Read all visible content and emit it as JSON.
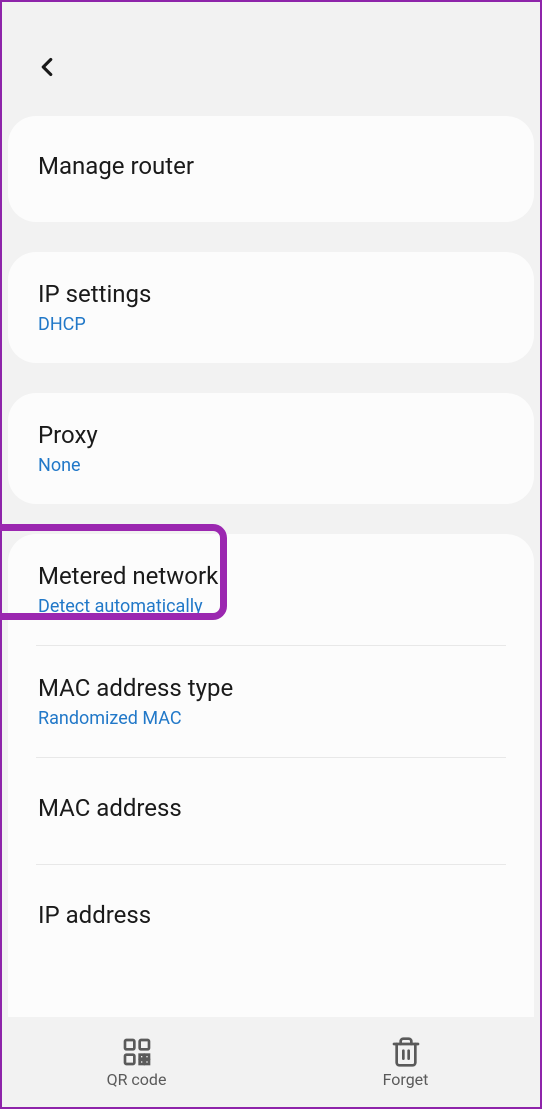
{
  "accent_color": "#2178c8",
  "cards": {
    "manage_router": {
      "title": "Manage router"
    },
    "ip_settings": {
      "title": "IP settings",
      "value": "DHCP"
    },
    "proxy": {
      "title": "Proxy",
      "value": "None"
    },
    "metered_network": {
      "title": "Metered network",
      "value": "Detect automatically"
    },
    "mac_type": {
      "title": "MAC address type",
      "value": "Randomized MAC"
    },
    "mac_address": {
      "title": "MAC address"
    },
    "ip_address": {
      "title": "IP address"
    }
  },
  "bottom": {
    "qr": "QR code",
    "forget": "Forget"
  }
}
